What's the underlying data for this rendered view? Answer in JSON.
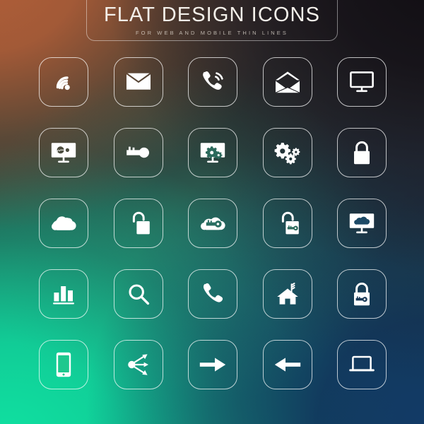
{
  "banner": {
    "title": "FLAT DESIGN ICONS",
    "subtitle": "FOR WEB AND MOBILE THIN LINES"
  },
  "palette": {
    "icon_color": "#FFFFFF",
    "tile_border": "rgba(255,255,255,0.72)",
    "bg_top_left": "#B25F38",
    "bg_top_right": "#110E13",
    "bg_bottom_left": "#10DFA0",
    "bg_bottom_right": "#123A66",
    "title_color": "#F3EFE9",
    "subtitle_color": "#ECE4DB"
  },
  "grid": {
    "columns": 5,
    "rows": 5,
    "total_icons": 25,
    "tiles": [
      {
        "row": 1,
        "col": 1,
        "icon": "wifi-signal-icon",
        "label": "Wifi signal"
      },
      {
        "row": 1,
        "col": 2,
        "icon": "envelope-closed-icon",
        "label": "Closed envelope"
      },
      {
        "row": 1,
        "col": 3,
        "icon": "phone-ringing-icon",
        "label": "Ringing phone handset"
      },
      {
        "row": 1,
        "col": 4,
        "icon": "envelope-open-icon",
        "label": "Open envelope"
      },
      {
        "row": 1,
        "col": 5,
        "icon": "monitor-icon",
        "label": "Desktop monitor"
      },
      {
        "row": 2,
        "col": 1,
        "icon": "monitor-key-icon",
        "label": "Monitor with key"
      },
      {
        "row": 2,
        "col": 2,
        "icon": "key-icon",
        "label": "Key"
      },
      {
        "row": 2,
        "col": 3,
        "icon": "monitor-gears-icon",
        "label": "Monitor with gears"
      },
      {
        "row": 2,
        "col": 4,
        "icon": "gears-icon",
        "label": "Gears settings"
      },
      {
        "row": 2,
        "col": 5,
        "icon": "padlock-closed-icon",
        "label": "Closed padlock"
      },
      {
        "row": 3,
        "col": 1,
        "icon": "cloud-icon",
        "label": "Cloud"
      },
      {
        "row": 3,
        "col": 2,
        "icon": "padlock-open-icon",
        "label": "Open padlock"
      },
      {
        "row": 3,
        "col": 3,
        "icon": "cloud-key-icon",
        "label": "Cloud with key"
      },
      {
        "row": 3,
        "col": 4,
        "icon": "padlock-open-key-icon",
        "label": "Open padlock with key"
      },
      {
        "row": 3,
        "col": 5,
        "icon": "monitor-cloud-icon",
        "label": "Monitor with cloud"
      },
      {
        "row": 4,
        "col": 1,
        "icon": "bar-chart-icon",
        "label": "Bar chart"
      },
      {
        "row": 4,
        "col": 2,
        "icon": "search-icon",
        "label": "Magnifying glass search"
      },
      {
        "row": 4,
        "col": 3,
        "icon": "phone-handset-icon",
        "label": "Phone handset"
      },
      {
        "row": 4,
        "col": 4,
        "icon": "home-antenna-icon",
        "label": "House with antenna"
      },
      {
        "row": 4,
        "col": 5,
        "icon": "padlock-key-icon",
        "label": "Padlock with key"
      },
      {
        "row": 5,
        "col": 1,
        "icon": "smartphone-icon",
        "label": "Smartphone"
      },
      {
        "row": 5,
        "col": 2,
        "icon": "share-network-icon",
        "label": "Share network"
      },
      {
        "row": 5,
        "col": 3,
        "icon": "arrow-right-icon",
        "label": "Right arrow"
      },
      {
        "row": 5,
        "col": 4,
        "icon": "arrow-left-icon",
        "label": "Left arrow"
      },
      {
        "row": 5,
        "col": 5,
        "icon": "laptop-icon",
        "label": "Laptop"
      }
    ]
  }
}
